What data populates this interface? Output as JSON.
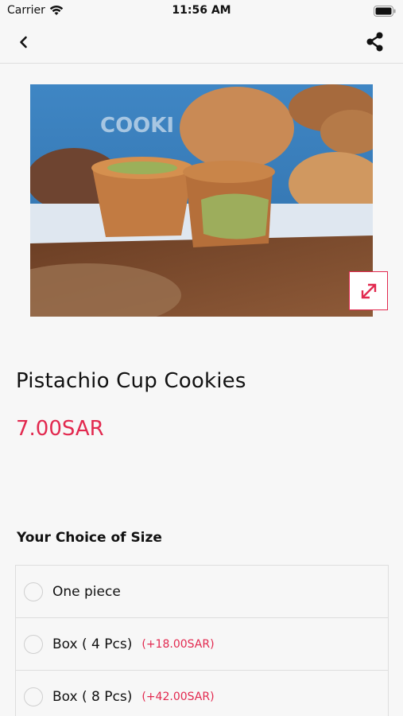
{
  "status_bar": {
    "carrier": "Carrier",
    "time": "11:56 AM"
  },
  "nav": {
    "back_icon": "chevron-left-icon",
    "share_icon": "share-icon"
  },
  "product": {
    "image_alt": "Pistachio cup cookies",
    "title": "Pistachio Cup Cookies",
    "price": "7.00SAR",
    "expand_icon": "expand-icon"
  },
  "size_section": {
    "title": "Your Choice of Size",
    "options": [
      {
        "label": "One piece",
        "extra": ""
      },
      {
        "label": "Box ( 4 Pcs)",
        "extra": "(+18.00SAR)"
      },
      {
        "label": "Box ( 8 Pcs)",
        "extra": "(+42.00SAR)"
      }
    ]
  },
  "colors": {
    "accent": "#e2294f",
    "background": "#f7f7f7"
  }
}
